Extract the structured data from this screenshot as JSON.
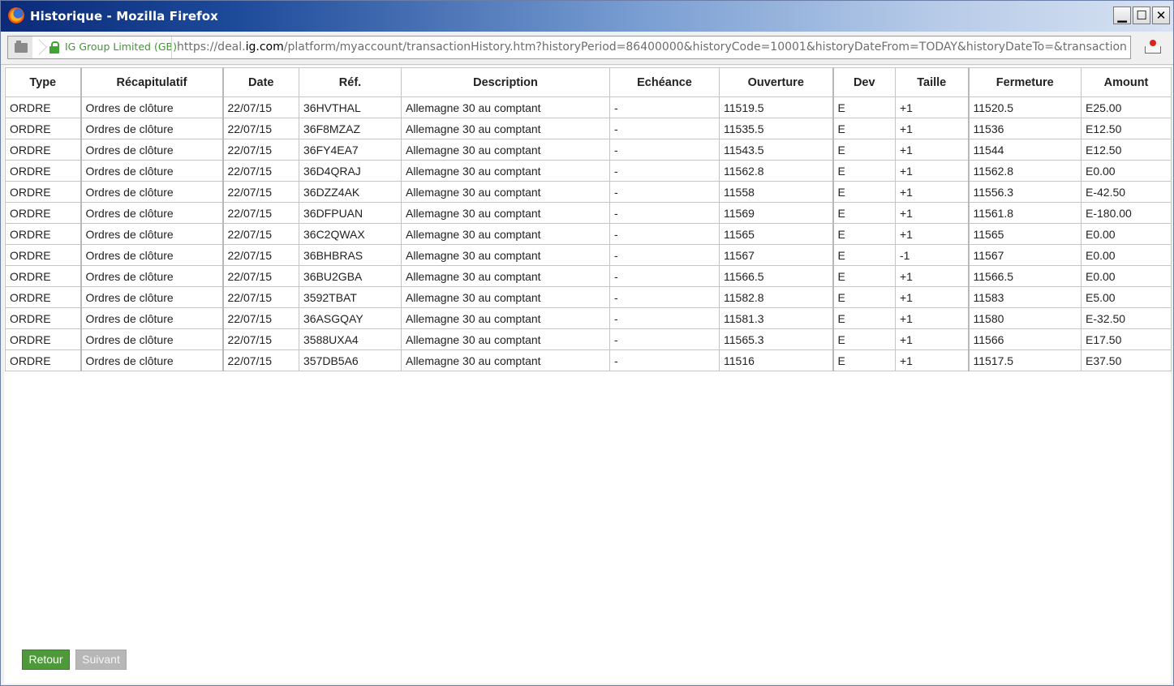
{
  "window": {
    "title": "Historique - Mozilla Firefox",
    "controls": {
      "minimize": "▁",
      "maximize": "☐",
      "close": "✕"
    }
  },
  "navbar": {
    "identity": "IG Group Limited (GB)",
    "url_prefix": "https://deal.",
    "url_host": "ig.com",
    "url_rest": "/platform/myaccount/transactionHistory.htm?historyPeriod=86400000&historyCode=10001&historyDateFrom=TODAY&historyDateTo=&transactionHistoryPageNumber="
  },
  "table": {
    "headers": [
      "Type",
      "Récapitulatif",
      "Date",
      "Réf.",
      "Description",
      "Echéance",
      "Ouverture",
      "Dev",
      "Taille",
      "Fermeture",
      "Amount"
    ],
    "rows": [
      [
        "ORDRE",
        "Ordres de clôture",
        "22/07/15",
        "36HVTHAL",
        "Allemagne 30 au comptant",
        "-",
        "11519.5",
        "E",
        "+1",
        "11520.5",
        "E25.00"
      ],
      [
        "ORDRE",
        "Ordres de clôture",
        "22/07/15",
        "36F8MZAZ",
        "Allemagne 30 au comptant",
        "-",
        "11535.5",
        "E",
        "+1",
        "11536",
        "E12.50"
      ],
      [
        "ORDRE",
        "Ordres de clôture",
        "22/07/15",
        "36FY4EA7",
        "Allemagne 30 au comptant",
        "-",
        "11543.5",
        "E",
        "+1",
        "11544",
        "E12.50"
      ],
      [
        "ORDRE",
        "Ordres de clôture",
        "22/07/15",
        "36D4QRAJ",
        "Allemagne 30 au comptant",
        "-",
        "11562.8",
        "E",
        "+1",
        "11562.8",
        "E0.00"
      ],
      [
        "ORDRE",
        "Ordres de clôture",
        "22/07/15",
        "36DZZ4AK",
        "Allemagne 30 au comptant",
        "-",
        "11558",
        "E",
        "+1",
        "11556.3",
        "E-42.50"
      ],
      [
        "ORDRE",
        "Ordres de clôture",
        "22/07/15",
        "36DFPUAN",
        "Allemagne 30 au comptant",
        "-",
        "11569",
        "E",
        "+1",
        "11561.8",
        "E-180.00"
      ],
      [
        "ORDRE",
        "Ordres de clôture",
        "22/07/15",
        "36C2QWAX",
        "Allemagne 30 au comptant",
        "-",
        "11565",
        "E",
        "+1",
        "11565",
        "E0.00"
      ],
      [
        "ORDRE",
        "Ordres de clôture",
        "22/07/15",
        "36BHBRAS",
        "Allemagne 30 au comptant",
        "-",
        "11567",
        "E",
        "-1",
        "11567",
        "E0.00"
      ],
      [
        "ORDRE",
        "Ordres de clôture",
        "22/07/15",
        "36BU2GBA",
        "Allemagne 30 au comptant",
        "-",
        "11566.5",
        "E",
        "+1",
        "11566.5",
        "E0.00"
      ],
      [
        "ORDRE",
        "Ordres de clôture",
        "22/07/15",
        "3592TBAT",
        "Allemagne 30 au comptant",
        "-",
        "11582.8",
        "E",
        "+1",
        "11583",
        "E5.00"
      ],
      [
        "ORDRE",
        "Ordres de clôture",
        "22/07/15",
        "36ASGQAY",
        "Allemagne 30 au comptant",
        "-",
        "11581.3",
        "E",
        "+1",
        "11580",
        "E-32.50"
      ],
      [
        "ORDRE",
        "Ordres de clôture",
        "22/07/15",
        "3588UXA4",
        "Allemagne 30 au comptant",
        "-",
        "11565.3",
        "E",
        "+1",
        "11566",
        "E17.50"
      ],
      [
        "ORDRE",
        "Ordres de clôture",
        "22/07/15",
        "357DB5A6",
        "Allemagne 30 au comptant",
        "-",
        "11516",
        "E",
        "+1",
        "11517.5",
        "E37.50"
      ]
    ]
  },
  "footer": {
    "back_label": "Retour",
    "next_label": "Suivant"
  },
  "colors": {
    "titlebar_dark": "#0b2a7a",
    "secure_green": "#3b9a2c",
    "retour_green": "#4e9a3a",
    "suivant_gray": "#b7b7b7"
  }
}
